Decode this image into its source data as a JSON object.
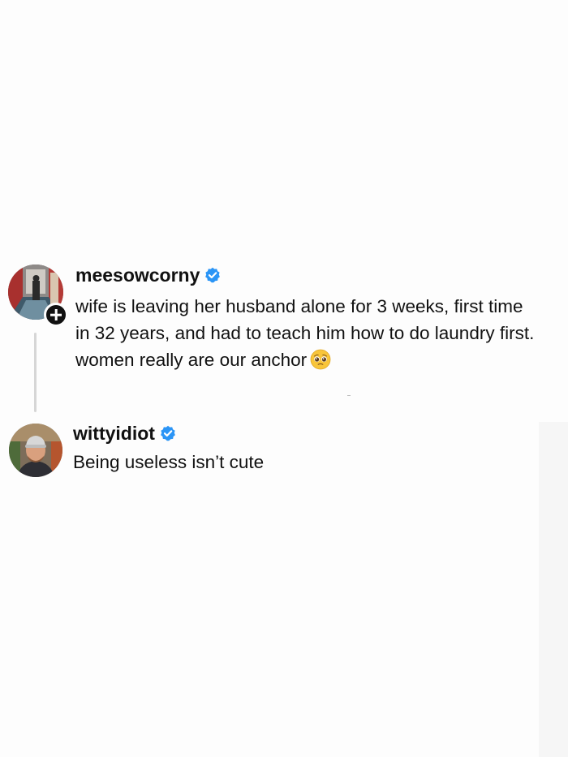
{
  "thread": {
    "main_post": {
      "username": "meesowcorny",
      "verified": true,
      "text": "wife is leaving her husband alone for 3 weeks, first time in 32 years, and had to teach him how to do laundry first. women really are our anchor",
      "emoji": "pleading-face",
      "avatar_icon": "profile-photo-hallway",
      "follow_icon": "plus-icon"
    },
    "reply": {
      "username": "wittyidiot",
      "verified": true,
      "text": "Being useless isn’t cute",
      "avatar_icon": "profile-photo-man-cap"
    },
    "colors": {
      "background": "#fdfdfd",
      "text": "#111111",
      "verified_badge": "#2b95f6",
      "thread_line": "#d6d6d6",
      "follow_badge": "#111111"
    }
  }
}
